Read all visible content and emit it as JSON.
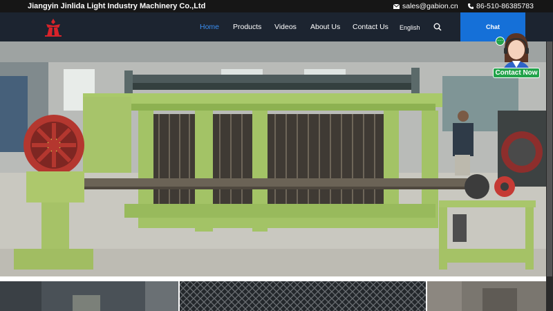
{
  "topbar": {
    "company_name": "Jiangyin Jinlida Light Industry Machinery Co.,Ltd",
    "email": "sales@gabion.cn",
    "phone": "86-510-86385783"
  },
  "nav": {
    "items": [
      {
        "label": "Home",
        "active": true
      },
      {
        "label": "Products",
        "active": false
      },
      {
        "label": "Videos",
        "active": false
      },
      {
        "label": "About Us",
        "active": false
      },
      {
        "label": "Contact Us",
        "active": false
      }
    ],
    "language": "English",
    "chat_label": "Chat",
    "accent_color": "#3b8ef0",
    "chat_color": "#1570d8",
    "icons": [
      "envelope-icon",
      "phone-icon",
      "search-icon",
      "company-logo"
    ]
  },
  "contact_widget": {
    "label": "Contact Now",
    "bubble": "···",
    "color": "#22a34a"
  },
  "hero": {
    "subject": "machine"
  }
}
